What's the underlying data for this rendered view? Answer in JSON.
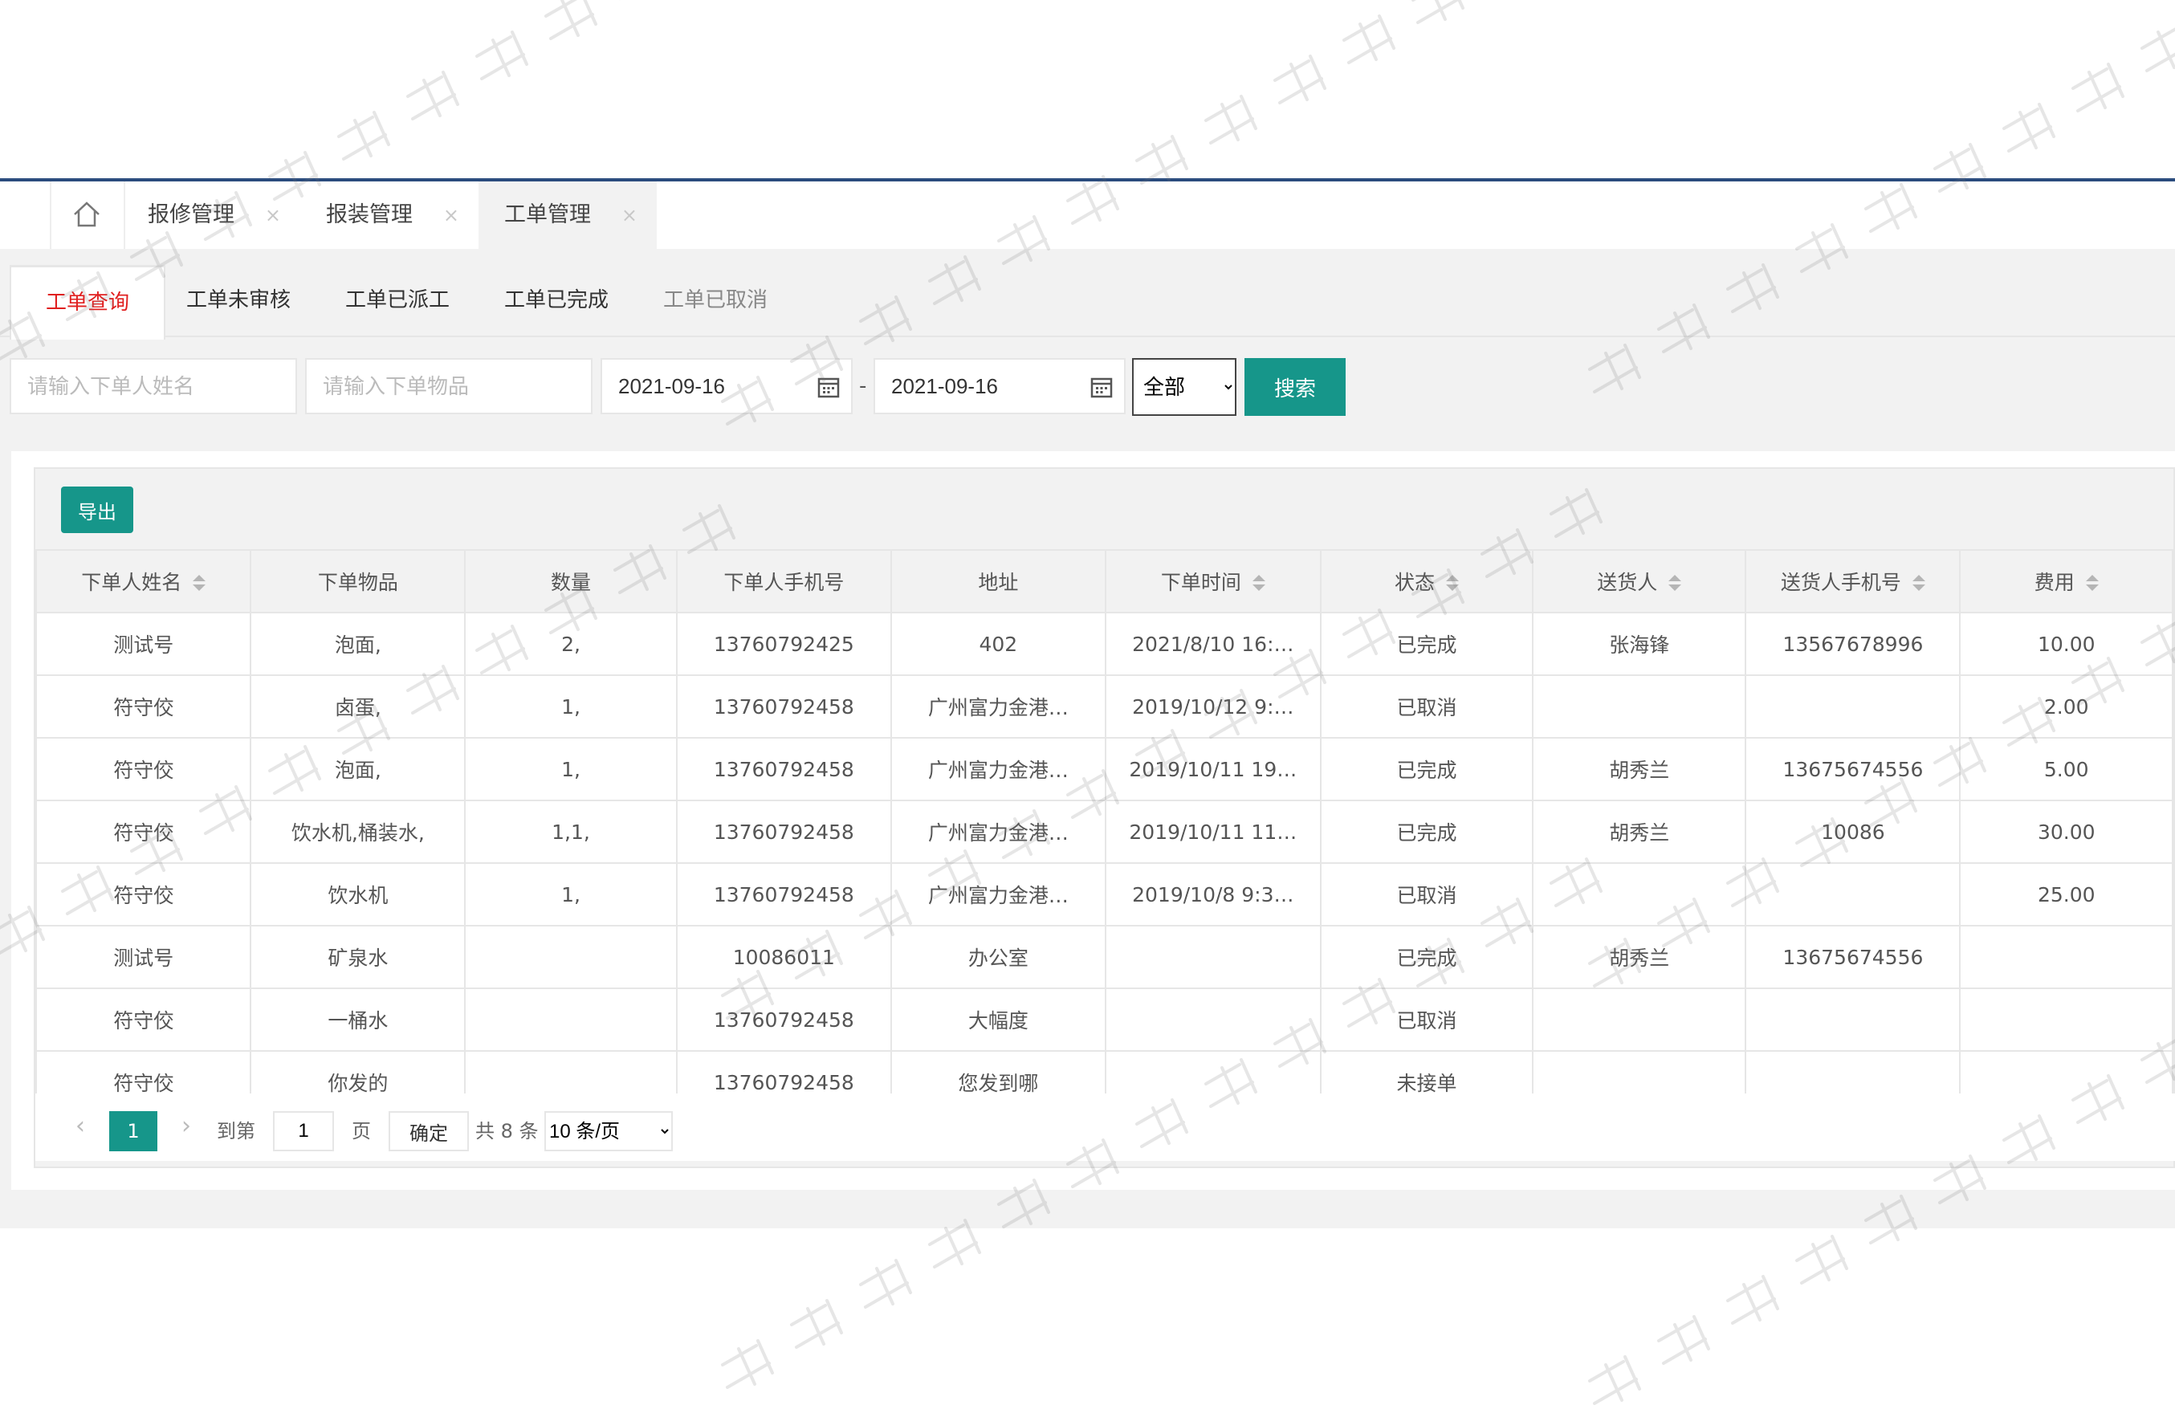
{
  "page_tabs": {
    "home_icon": "home-icon",
    "items": [
      {
        "label": "报修管理",
        "close": "×"
      },
      {
        "label": "报装管理",
        "close": "×"
      },
      {
        "label": "工单管理",
        "close": "×"
      }
    ]
  },
  "sub_tabs": [
    "工单查询",
    "工单未审核",
    "工单已派工",
    "工单已完成",
    "工单已取消"
  ],
  "filters": {
    "name_placeholder": "请输入下单人姓名",
    "item_placeholder": "请输入下单物品",
    "date_from": "2021-09-16",
    "date_to": "2021-09-16",
    "separator": "-",
    "status_selected": "全部",
    "search_label": "搜索",
    "calendar_icon": "calendar-icon"
  },
  "export_label": "导出",
  "table": {
    "columns": [
      "下单人姓名",
      "下单物品",
      "数量",
      "下单人手机号",
      "地址",
      "下单时间",
      "状态",
      "送货人",
      "送货人手机号",
      "费用"
    ],
    "rows": [
      [
        "测试号",
        "泡面,",
        "2,",
        "13760792425",
        "402",
        "2021/8/10 16:…",
        "已完成",
        "张海锋",
        "13567678996",
        "10.00"
      ],
      [
        "符守佼",
        "卤蛋,",
        "1,",
        "13760792458",
        "广州富力金港…",
        "2019/10/12 9:…",
        "已取消",
        "",
        "",
        "2.00"
      ],
      [
        "符守佼",
        "泡面,",
        "1,",
        "13760792458",
        "广州富力金港…",
        "2019/10/11 19…",
        "已完成",
        "胡秀兰",
        "13675674556",
        "5.00"
      ],
      [
        "符守佼",
        "饮水机,桶装水,",
        "1,1,",
        "13760792458",
        "广州富力金港…",
        "2019/10/11 11…",
        "已完成",
        "胡秀兰",
        "10086",
        "30.00"
      ],
      [
        "符守佼",
        "饮水机",
        "1,",
        "13760792458",
        "广州富力金港…",
        "2019/10/8 9:3…",
        "已取消",
        "",
        "",
        "25.00"
      ],
      [
        "测试号",
        "矿泉水",
        "",
        "10086011",
        "办公室",
        "",
        "已完成",
        "胡秀兰",
        "13675674556",
        ""
      ],
      [
        "符守佼",
        "一桶水",
        "",
        "13760792458",
        "大幅度",
        "",
        "已取消",
        "",
        "",
        ""
      ],
      [
        "符守佼",
        "你发的",
        "",
        "13760792458",
        "您发到哪",
        "",
        "未接单",
        "",
        "",
        ""
      ]
    ]
  },
  "pagination": {
    "prev": "‹",
    "current": "1",
    "next": "›",
    "goto_label": "到第",
    "page_value": "1",
    "page_unit": "页",
    "confirm_label": "确定",
    "total_label": "共 8 条",
    "page_size": "10 条/页"
  },
  "watermark": {
    "text": "广州市国万电子科技有限公司"
  },
  "colors": {
    "accent": "#16968a",
    "active_tab_text": "#e02020",
    "top_rule": "#2b4c7e"
  }
}
